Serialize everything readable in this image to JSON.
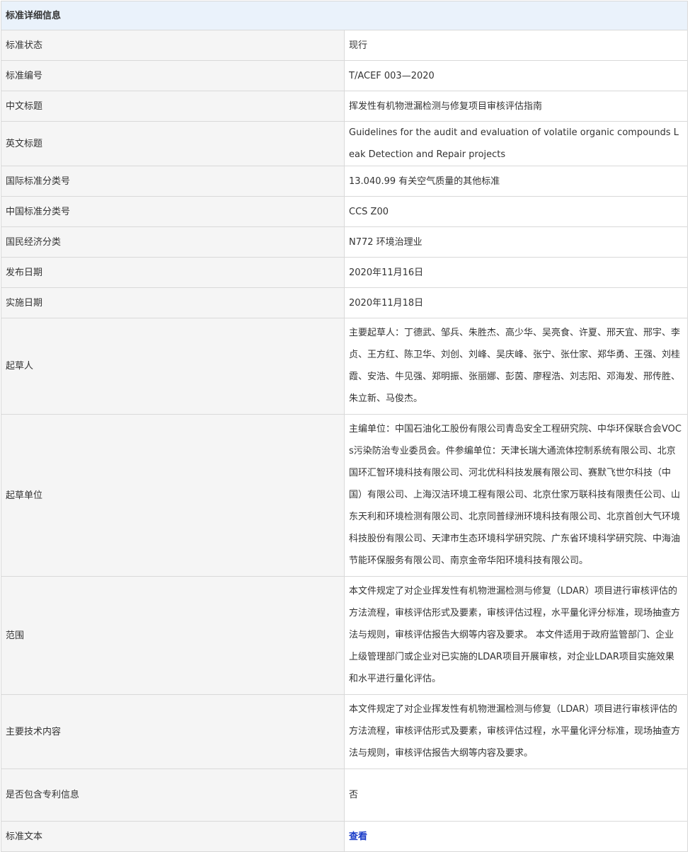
{
  "header": {
    "title": "标准详细信息"
  },
  "rows": [
    {
      "label": "标准状态",
      "value": "现行"
    },
    {
      "label": "标准编号",
      "value": "T/ACEF 003—2020"
    },
    {
      "label": "中文标题",
      "value": "挥发性有机物泄漏检测与修复项目审核评估指南"
    },
    {
      "label": "英文标题",
      "value": "Guidelines for the audit and evaluation of volatile organic compounds Leak Detection and Repair projects"
    },
    {
      "label": "国际标准分类号",
      "value": "13.040.99 有关空气质量的其他标准"
    },
    {
      "label": "中国标准分类号",
      "value": "CCS Z00"
    },
    {
      "label": "国民经济分类",
      "value": "N772 环境治理业"
    },
    {
      "label": "发布日期",
      "value": "2020年11月16日"
    },
    {
      "label": "实施日期",
      "value": "2020年11月18日"
    },
    {
      "label": "起草人",
      "value": "主要起草人：丁德武、邹兵、朱胜杰、高少华、吴亮食、许夏、邢天宜、邢宇、李贞、王方红、陈卫华、刘创、刘峰、吴庆峰、张宁、张仕家、郑华勇、王强、刘桂霞、安浩、牛见强、郑明振、张丽娜、彭茵、廖程浩、刘志阳、邓海发、邢传胜、朱立新、马俊杰。"
    },
    {
      "label": "起草单位",
      "value": "主编单位：中国石油化工股份有限公司青岛安全工程研究院、中华环保联合会VOCs污染防治专业委员会。件参编单位：天津长瑞大通流体控制系统有限公司、北京国环汇智环境科技有限公司、河北优科科技发展有限公司、赛默飞世尔科技（中国）有限公司、上海汉洁环境工程有限公司、北京仕家万联科技有限责任公司、山东天利和环境检测有限公司、北京同普绿洲环境科技有限公司、北京首创大气环境科技股份有限公司、天津市生态环境科学研究院、广东省环境科学研究院、中海油节能环保服务有限公司、南京金帝华阳环境科技有限公司。"
    },
    {
      "label": "范围",
      "value": "本文件规定了对企业挥发性有机物泄漏检测与修复（LDAR）项目进行审核评估的方法流程，审核评估形式及要素，审核评估过程，水平量化评分标准，现场抽查方法与规则，审核评估报告大纲等内容及要求。 本文件适用于政府监管部门、企业上级管理部门或企业对已实施的LDAR项目开展审核，对企业LDAR项目实施效果和水平进行量化评估。"
    },
    {
      "label": "主要技术内容",
      "value": "本文件规定了对企业挥发性有机物泄漏检测与修复（LDAR）项目进行审核评估的方法流程，审核评估形式及要素，审核评估过程，水平量化评分标准，现场抽查方法与规则，审核评估报告大纲等内容及要求。"
    },
    {
      "label": "是否包含专利信息",
      "value": "否"
    },
    {
      "label": "标准文本",
      "value": "查看"
    }
  ]
}
